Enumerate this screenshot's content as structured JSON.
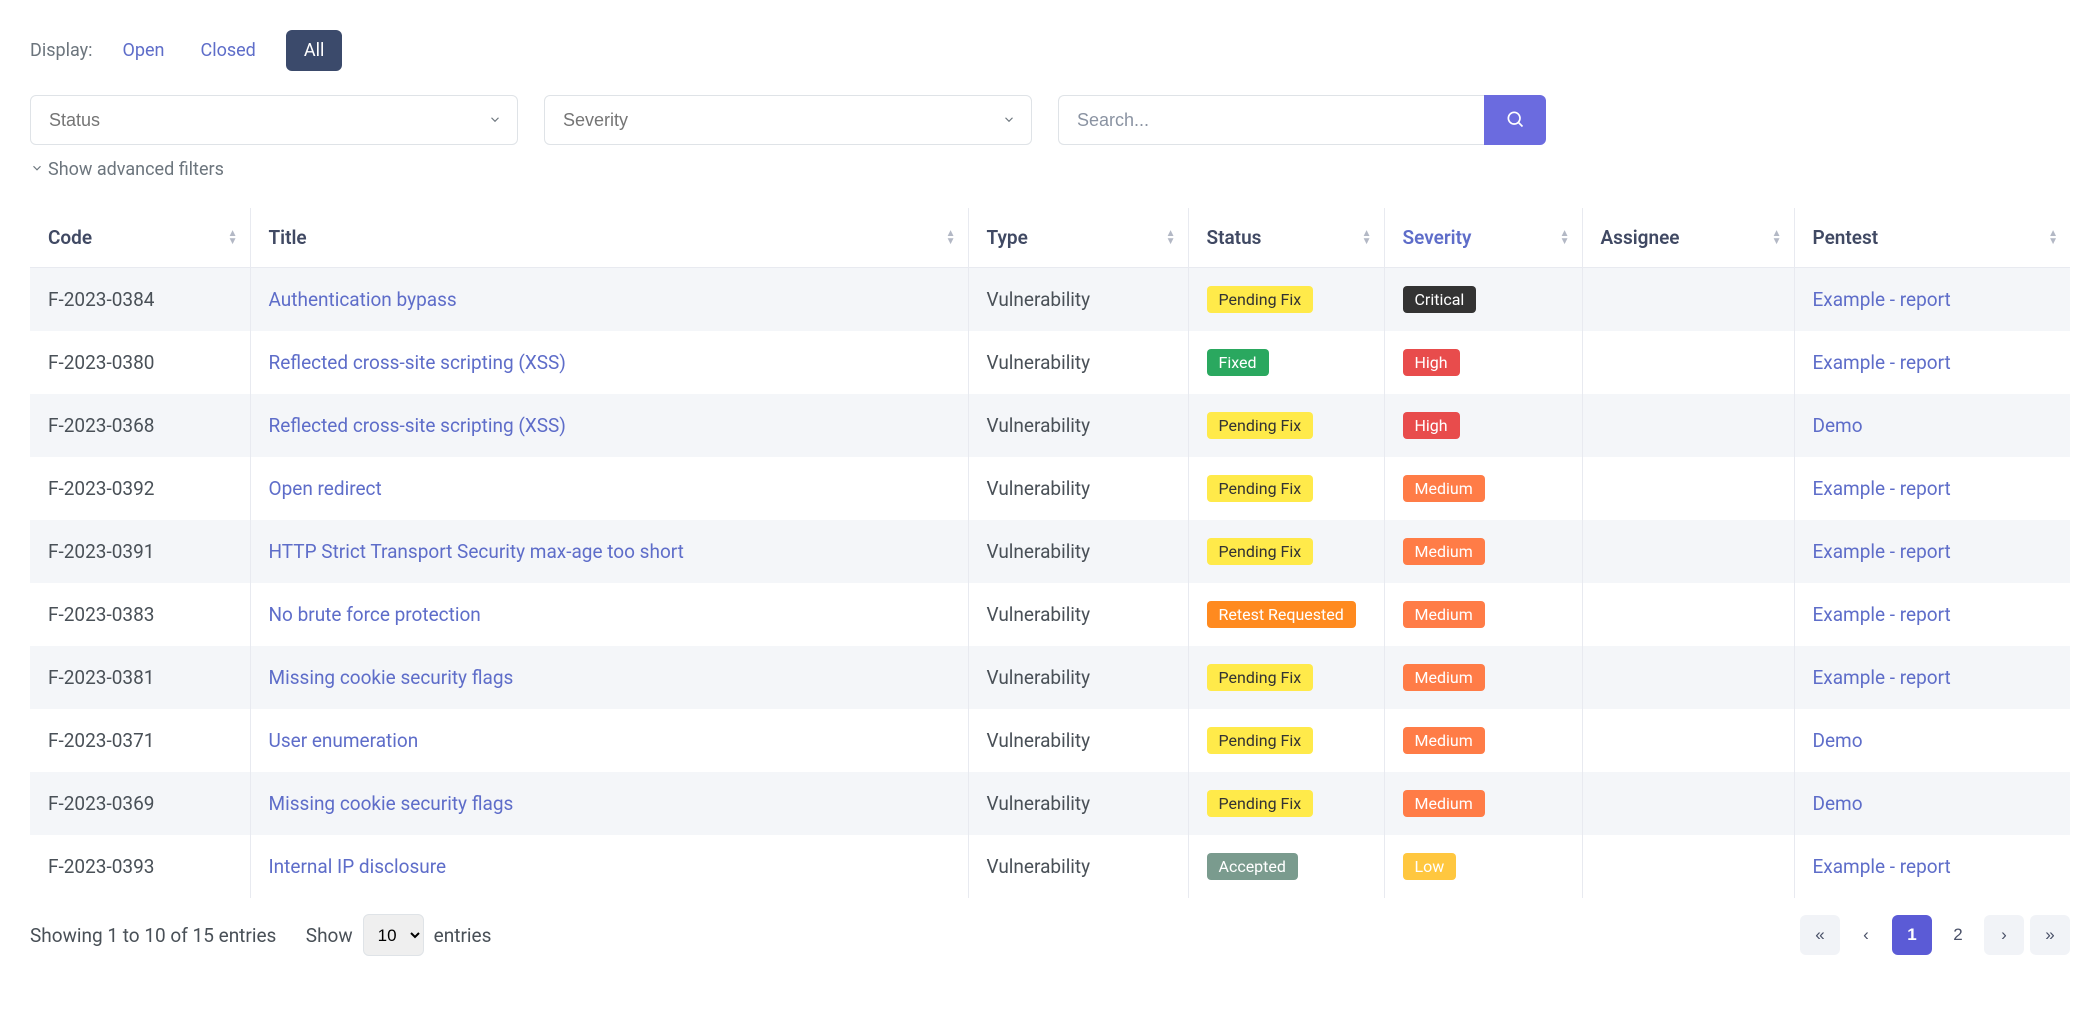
{
  "display": {
    "label": "Display:",
    "open": "Open",
    "closed": "Closed",
    "all": "All"
  },
  "filters": {
    "status_placeholder": "Status",
    "severity_placeholder": "Severity",
    "search_placeholder": "Search...",
    "advanced_label": "Show advanced filters"
  },
  "columns": {
    "code": "Code",
    "title": "Title",
    "type": "Type",
    "status": "Status",
    "severity": "Severity",
    "assignee": "Assignee",
    "pentest": "Pentest"
  },
  "rows": [
    {
      "code": "F-2023-0384",
      "title": "Authentication bypass",
      "type": "Vulnerability",
      "status": "Pending Fix",
      "status_cls": "yellow",
      "severity": "Critical",
      "severity_cls": "dark",
      "assignee": "",
      "pentest": "Example - report"
    },
    {
      "code": "F-2023-0380",
      "title": "Reflected cross-site scripting (XSS)",
      "type": "Vulnerability",
      "status": "Fixed",
      "status_cls": "green",
      "severity": "High",
      "severity_cls": "red",
      "assignee": "",
      "pentest": "Example - report"
    },
    {
      "code": "F-2023-0368",
      "title": "Reflected cross-site scripting (XSS)",
      "type": "Vulnerability",
      "status": "Pending Fix",
      "status_cls": "yellow",
      "severity": "High",
      "severity_cls": "red",
      "assignee": "",
      "pentest": "Demo"
    },
    {
      "code": "F-2023-0392",
      "title": "Open redirect",
      "type": "Vulnerability",
      "status": "Pending Fix",
      "status_cls": "yellow",
      "severity": "Medium",
      "severity_cls": "orange",
      "assignee": "",
      "pentest": "Example - report"
    },
    {
      "code": "F-2023-0391",
      "title": "HTTP Strict Transport Security max-age too short",
      "type": "Vulnerability",
      "status": "Pending Fix",
      "status_cls": "yellow",
      "severity": "Medium",
      "severity_cls": "orange",
      "assignee": "",
      "pentest": "Example - report"
    },
    {
      "code": "F-2023-0383",
      "title": "No brute force protection",
      "type": "Vulnerability",
      "status": "Retest Requested",
      "status_cls": "orange-btn",
      "severity": "Medium",
      "severity_cls": "orange",
      "assignee": "",
      "pentest": "Example - report"
    },
    {
      "code": "F-2023-0381",
      "title": "Missing cookie security flags",
      "type": "Vulnerability",
      "status": "Pending Fix",
      "status_cls": "yellow",
      "severity": "Medium",
      "severity_cls": "orange",
      "assignee": "",
      "pentest": "Example - report"
    },
    {
      "code": "F-2023-0371",
      "title": "User enumeration",
      "type": "Vulnerability",
      "status": "Pending Fix",
      "status_cls": "yellow",
      "severity": "Medium",
      "severity_cls": "orange",
      "assignee": "",
      "pentest": "Demo"
    },
    {
      "code": "F-2023-0369",
      "title": "Missing cookie security flags",
      "type": "Vulnerability",
      "status": "Pending Fix",
      "status_cls": "yellow",
      "severity": "Medium",
      "severity_cls": "orange",
      "assignee": "",
      "pentest": "Demo"
    },
    {
      "code": "F-2023-0393",
      "title": "Internal IP disclosure",
      "type": "Vulnerability",
      "status": "Accepted",
      "status_cls": "graygreen",
      "severity": "Low",
      "severity_cls": "yellow-low",
      "assignee": "",
      "pentest": "Example - report"
    }
  ],
  "footer": {
    "showing": "Showing 1 to 10 of 15 entries",
    "show_label": "Show",
    "entries_label": "entries",
    "page_size": "10",
    "pages": [
      "1",
      "2"
    ]
  }
}
